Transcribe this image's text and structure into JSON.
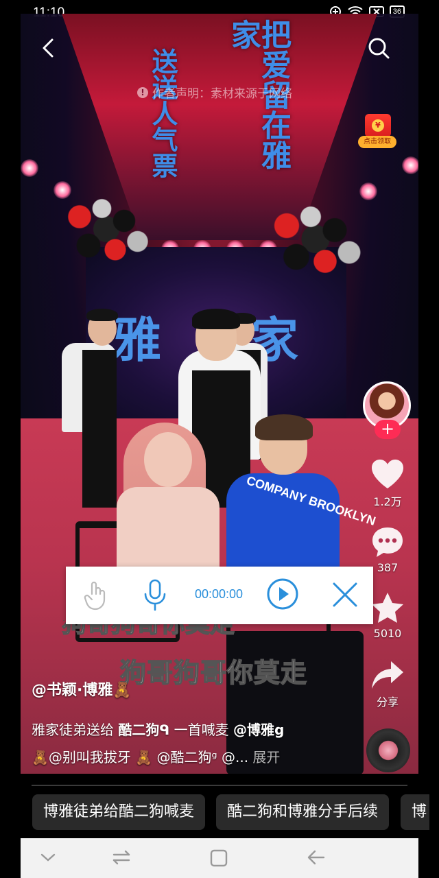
{
  "status_bar": {
    "time": "11:10",
    "battery": "36"
  },
  "video": {
    "watermark": "作者声明：素材来源于网络",
    "ceiling_text_left": "送送人气票",
    "ceiling_text_right": "把爱留在雅家",
    "wall_text": [
      "雅",
      "家"
    ],
    "shirt_text": "COMPANY BROOKLYN",
    "subtitle": "狗哥狗哥你莫走",
    "red_packet_label": "点击领取"
  },
  "side_actions": {
    "like_count": "1.2万",
    "comment_count": "387",
    "favorite_count": "5010",
    "share_label": "分享"
  },
  "post": {
    "author": "@书颖·博雅🧸",
    "line1_prefix": "雅家徒弟送给 ",
    "line1_mention1": "酷二狗ᑫ",
    "line1_middle": " 一首喊麦 ",
    "line1_mention2": "@博雅g",
    "line2": "🧸@别叫我拔牙 🧸 @酷二狗ᵍ @...",
    "expand": "展开"
  },
  "recorder": {
    "time": "00:00:00"
  },
  "related_searches": [
    "博雅徒弟给酷二狗喊麦",
    "酷二狗和博雅分手后续",
    "博"
  ],
  "colors": {
    "accent_red": "#fe2c55",
    "recorder_blue": "#2a8fdb"
  }
}
